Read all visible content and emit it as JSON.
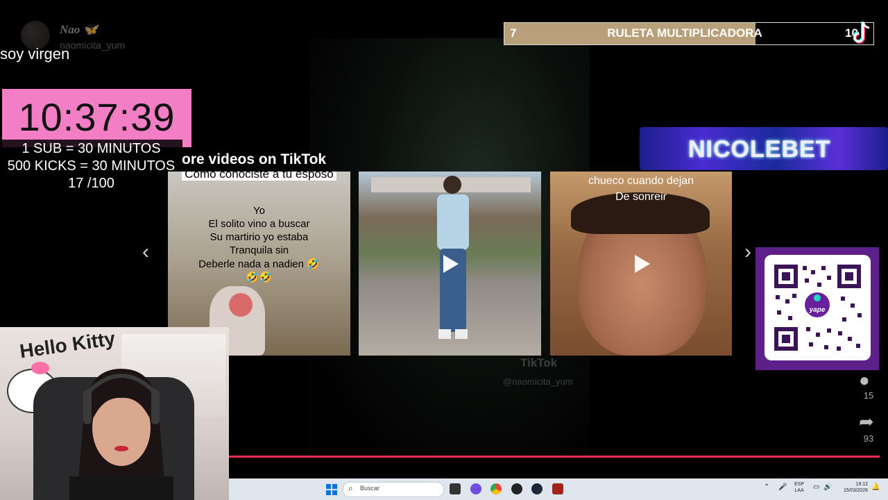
{
  "uploader": {
    "name": "Nao 🦋",
    "handle": "naomicita_yum"
  },
  "overlay_message": "soy virgen",
  "timer": {
    "time": "10:37:39",
    "rules": [
      "1 SUB      = 30 MINUTOS",
      "500 KICKS = 30 MINUTOS",
      "17 /100"
    ],
    "color": "#f27fc6"
  },
  "ruleta": {
    "min": "7",
    "title": "RULETA MULTIPLICADORA",
    "max": "10",
    "progress": 0.68
  },
  "sponsor": {
    "name": "NICOLEBET"
  },
  "more_videos": {
    "title": "ore videos on TikTok",
    "videos": [
      {
        "caption_top": "Como conociste a tu esposo",
        "caption_lines": [
          "Yo",
          "El solito vino a buscar",
          "Su martirio yo estaba",
          "Tranquila sin",
          "Deberle nada a nadien 🤣",
          "🤣🤣"
        ]
      },
      {
        "caption_top": "",
        "caption_lines": []
      },
      {
        "caption_top": "chueco cuando dejan",
        "caption_lines": [
          "De sonreir"
        ]
      }
    ]
  },
  "qr": {
    "brand": "yape"
  },
  "side_actions": {
    "comments": "15",
    "shares": "93"
  },
  "watermark": {
    "logo": "TikTok",
    "handle": "@naomicita_yum"
  },
  "webcam": {
    "wall_text": "Hello Kitty"
  },
  "video_progress": 1.0,
  "taskbar": {
    "search_placeholder": "Buscar",
    "lang": "ESP",
    "lang2": "LAA",
    "time": "19:12",
    "date": "15/03/2026"
  },
  "colors": {
    "accent": "#fe2c55",
    "qr_frame": "#5d1f8a",
    "taskbar": "#dfe6ee"
  }
}
